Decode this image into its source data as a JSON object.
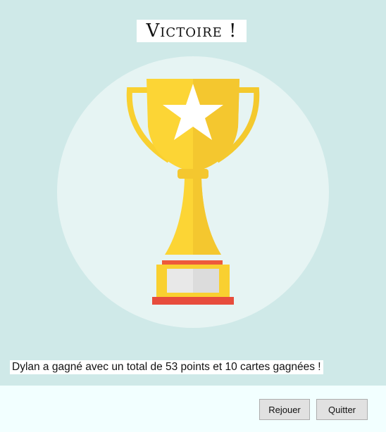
{
  "header": {
    "title": "Victoire !"
  },
  "illustration": {
    "icon": "trophy-icon",
    "circle_color": "#e6f4f3",
    "gold": "#f9d030",
    "base_red": "#e74c3c"
  },
  "result": {
    "message": "Dylan a gagné avec un total de 53 points et 10 cartes gagnées !"
  },
  "actions": {
    "replay_label": "Rejouer",
    "quit_label": "Quitter"
  }
}
